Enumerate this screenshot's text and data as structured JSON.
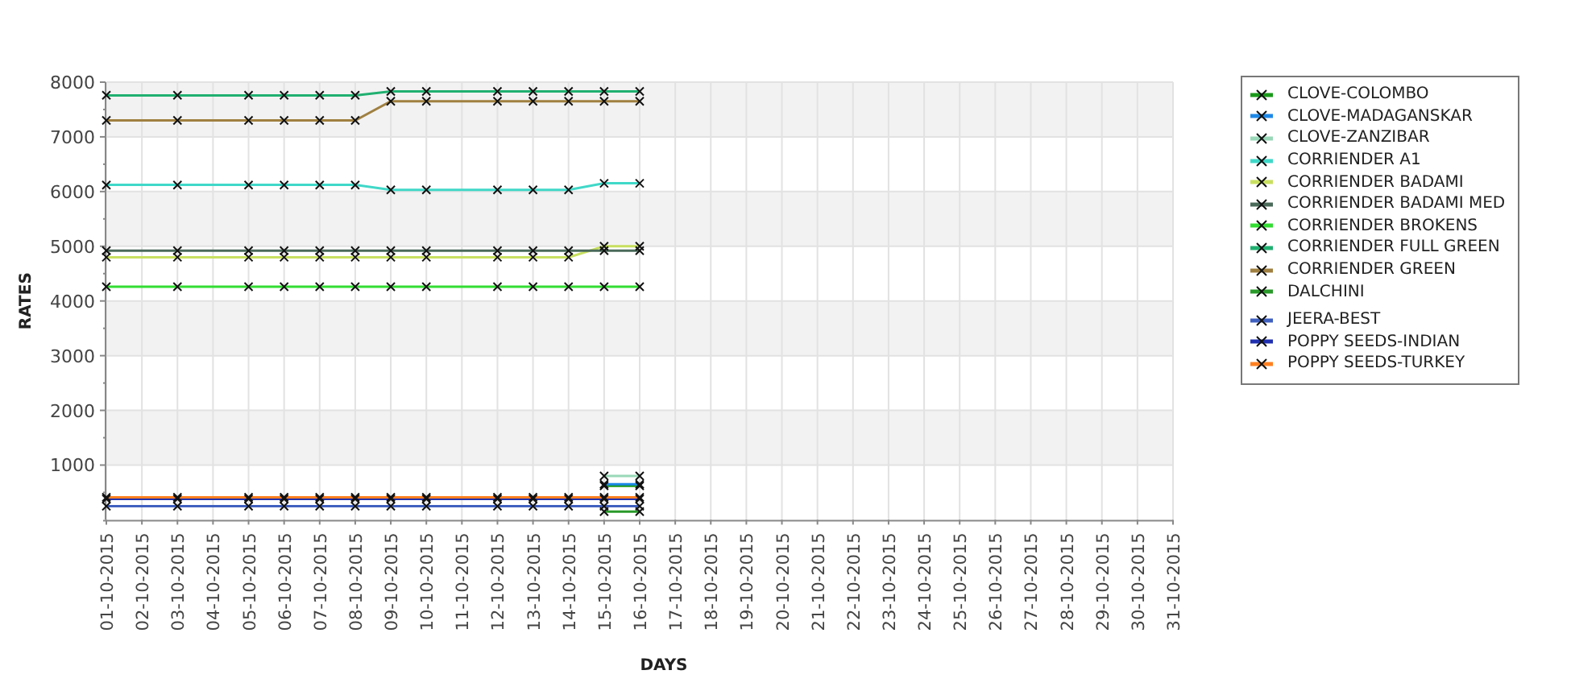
{
  "chart": {
    "chart_data": {
      "type": "line",
      "xlabel": "DAYS",
      "ylabel": "RATES",
      "categories": [
        "01-10-2015",
        "02-10-2015",
        "03-10-2015",
        "04-10-2015",
        "05-10-2015",
        "06-10-2015",
        "07-10-2015",
        "08-10-2015",
        "09-10-2015",
        "10-10-2015",
        "11-10-2015",
        "12-10-2015",
        "13-10-2015",
        "14-10-2015",
        "15-10-2015",
        "16-10-2015",
        "17-10-2015",
        "18-10-2015",
        "19-10-2015",
        "20-10-2015",
        "21-10-2015",
        "22-10-2015",
        "23-10-2015",
        "24-10-2015",
        "25-10-2015",
        "26-10-2015",
        "27-10-2015",
        "28-10-2015",
        "29-10-2015",
        "30-10-2015",
        "31-10-2015"
      ],
      "ylim": [
        0,
        8000
      ],
      "grid": true,
      "yticks": [
        1000,
        2000,
        3000,
        4000,
        5000,
        6000,
        7000,
        8000
      ],
      "series": [
        {
          "name": "CLOVE-COLOMBO",
          "marker": "x",
          "color": "#1a9a1a",
          "values": [
            null,
            null,
            null,
            null,
            null,
            null,
            null,
            null,
            null,
            null,
            null,
            null,
            null,
            null,
            620,
            620,
            null,
            null,
            null,
            null,
            null,
            null,
            null,
            null,
            null,
            null,
            null,
            null,
            null,
            null,
            null
          ]
        },
        {
          "name": "CLOVE-MADAGANSKAR",
          "marker": "x",
          "color": "#1e88e8",
          "values": [
            null,
            null,
            null,
            null,
            null,
            null,
            null,
            null,
            null,
            null,
            null,
            null,
            null,
            null,
            650,
            650,
            null,
            null,
            null,
            null,
            null,
            null,
            null,
            null,
            null,
            null,
            null,
            null,
            null,
            null,
            null
          ]
        },
        {
          "name": "CLOVE-ZANZIBAR",
          "marker": "x",
          "color": "#99d8b8",
          "values": [
            null,
            null,
            null,
            null,
            null,
            null,
            null,
            null,
            null,
            null,
            null,
            null,
            null,
            null,
            800,
            800,
            null,
            null,
            null,
            null,
            null,
            null,
            null,
            null,
            null,
            null,
            null,
            null,
            null,
            null,
            null
          ]
        },
        {
          "name": "CORRIENDER A1",
          "marker": "x",
          "color": "#40d8c8",
          "values": [
            6120,
            null,
            6120,
            null,
            6120,
            6120,
            6120,
            6120,
            6030,
            6030,
            null,
            6030,
            6030,
            6030,
            6150,
            6150,
            null,
            null,
            null,
            null,
            null,
            null,
            null,
            null,
            null,
            null,
            null,
            null,
            null,
            null,
            null
          ]
        },
        {
          "name": "CORRIENDER BADAMI",
          "marker": "x",
          "color": "#c8e060",
          "values": [
            4800,
            null,
            4800,
            null,
            4800,
            4800,
            4800,
            4800,
            4800,
            4800,
            null,
            4800,
            4800,
            4800,
            5000,
            5000,
            null,
            null,
            null,
            null,
            null,
            null,
            null,
            null,
            null,
            null,
            null,
            null,
            null,
            null,
            null
          ]
        },
        {
          "name": "CORRIENDER BADAMI MED",
          "marker": "x",
          "color": "#4a6a5a",
          "values": [
            4920,
            null,
            4920,
            null,
            4920,
            4920,
            4920,
            4920,
            4920,
            4920,
            null,
            4920,
            4920,
            4920,
            4920,
            4920,
            null,
            null,
            null,
            null,
            null,
            null,
            null,
            null,
            null,
            null,
            null,
            null,
            null,
            null,
            null
          ]
        },
        {
          "name": "CORRIENDER BROKENS",
          "marker": "x",
          "color": "#33dd33",
          "values": [
            4260,
            null,
            4260,
            null,
            4260,
            4260,
            4260,
            4260,
            4260,
            4260,
            null,
            4260,
            4260,
            4260,
            4260,
            4260,
            null,
            null,
            null,
            null,
            null,
            null,
            null,
            null,
            null,
            null,
            null,
            null,
            null,
            null,
            null
          ]
        },
        {
          "name": "CORRIENDER FULL GREEN",
          "marker": "x",
          "color": "#20b070",
          "values": [
            7760,
            null,
            7760,
            null,
            7760,
            7760,
            7760,
            7760,
            7830,
            7830,
            null,
            7830,
            7830,
            7830,
            7830,
            7830,
            null,
            null,
            null,
            null,
            null,
            null,
            null,
            null,
            null,
            null,
            null,
            null,
            null,
            null,
            null
          ]
        },
        {
          "name": "CORRIENDER GREEN",
          "marker": "x",
          "color": "#a08040",
          "values": [
            7300,
            null,
            7300,
            null,
            7300,
            7300,
            7300,
            7300,
            7650,
            7650,
            null,
            7650,
            7650,
            7650,
            7650,
            7650,
            null,
            null,
            null,
            null,
            null,
            null,
            null,
            null,
            null,
            null,
            null,
            null,
            null,
            null,
            null
          ]
        },
        {
          "name": "DALCHINI",
          "marker": "x",
          "color": "#2a9a2a",
          "values": [
            null,
            null,
            null,
            null,
            null,
            null,
            null,
            null,
            null,
            null,
            null,
            null,
            null,
            null,
            150,
            150,
            null,
            null,
            null,
            null,
            null,
            null,
            null,
            null,
            null,
            null,
            null,
            null,
            null,
            null,
            null
          ]
        },
        {
          "name": "JEERA-BEST",
          "marker": "x",
          "color": "#4060c0",
          "values": [
            250,
            null,
            250,
            null,
            250,
            250,
            250,
            250,
            250,
            250,
            null,
            250,
            250,
            250,
            250,
            250,
            null,
            null,
            null,
            null,
            null,
            null,
            null,
            null,
            null,
            null,
            null,
            null,
            null,
            null,
            null
          ]
        },
        {
          "name": "POPPY SEEDS-INDIAN",
          "marker": "x",
          "color": "#2030b0",
          "values": [
            380,
            null,
            380,
            null,
            380,
            380,
            380,
            380,
            380,
            380,
            null,
            380,
            380,
            380,
            380,
            380,
            null,
            null,
            null,
            null,
            null,
            null,
            null,
            null,
            null,
            null,
            null,
            null,
            null,
            null,
            null
          ]
        },
        {
          "name": "POPPY SEEDS-TURKEY",
          "marker": "x",
          "color": "#ff8020",
          "values": [
            410,
            null,
            410,
            null,
            410,
            410,
            410,
            410,
            410,
            410,
            null,
            410,
            410,
            410,
            410,
            410,
            null,
            null,
            null,
            null,
            null,
            null,
            null,
            null,
            null,
            null,
            null,
            null,
            null,
            null,
            null
          ]
        }
      ]
    }
  }
}
